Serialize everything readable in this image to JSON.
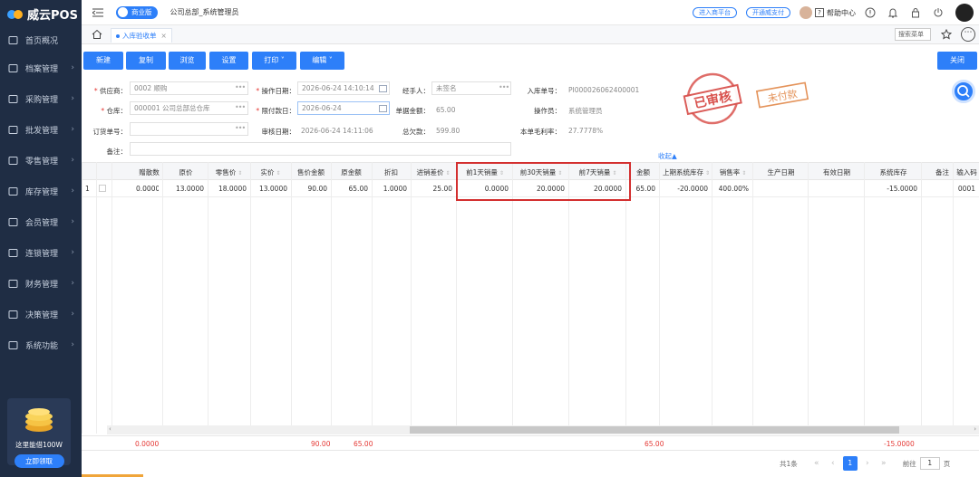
{
  "app": {
    "name": "威云POS",
    "edition": "商业版",
    "org_user": "公司总部_系统管理员"
  },
  "sidebar": {
    "items": [
      {
        "label": "首页概况",
        "icon": "home-icon"
      },
      {
        "label": "档案管理",
        "icon": "archive-icon"
      },
      {
        "label": "采购管理",
        "icon": "purchase-icon"
      },
      {
        "label": "批发管理",
        "icon": "wholesale-icon"
      },
      {
        "label": "零售管理",
        "icon": "retail-icon"
      },
      {
        "label": "库存管理",
        "icon": "inventory-icon"
      },
      {
        "label": "会员管理",
        "icon": "member-icon"
      },
      {
        "label": "连锁管理",
        "icon": "chain-icon"
      },
      {
        "label": "财务管理",
        "icon": "finance-icon"
      },
      {
        "label": "决策管理",
        "icon": "decision-icon"
      },
      {
        "label": "系统功能",
        "icon": "system-icon"
      }
    ],
    "promo": {
      "text": "这里能借100W",
      "button": "立即领取"
    }
  },
  "topbar": {
    "pill1": "进入商平台",
    "pill2": "开通威支付",
    "help": "帮助中心",
    "help_badge": "?"
  },
  "tabs": {
    "active": "入库验收单",
    "menu_search_placeholder": "搜索菜单",
    "more": "⋯"
  },
  "toolbar": {
    "new": "新建",
    "copy": "复制",
    "browse": "浏览",
    "settings": "设置",
    "print": "打印",
    "edit": "编辑",
    "close": "关闭"
  },
  "form": {
    "supplier_label": "供应商：",
    "supplier_value": "0002 顺购",
    "op_date_label": "操作日期：",
    "op_date_value": "2026-06-24 14:10:14",
    "handler_label": "经手人：",
    "handler_value": "未签名",
    "doc_no_label": "入库单号：",
    "doc_no_value": "PI000026062400001",
    "warehouse_label": "仓库：",
    "warehouse_value": "000001 公司总部总仓库",
    "pay_date_label": "限付款日：",
    "pay_date_value": "2026-06-24",
    "amount_label": "单据金额：",
    "amount_value": "65.00",
    "operator_label": "操作员：",
    "operator_value": "系统管理员",
    "order_no_label": "订货单号：",
    "order_no_value": "",
    "audit_date_label": "审核日期：",
    "audit_date_value": "2026-06-24 14:11:06",
    "debt_label": "总欠款：",
    "debt_value": "599.80",
    "margin_label": "本单毛利率：",
    "margin_value": "27.7778%",
    "remark_label": "备注：",
    "remark_value": "",
    "collapse": "收起▲",
    "stamp_audited": "已审核",
    "stamp_unpaid": "未付款"
  },
  "table": {
    "headers": [
      "赠散数",
      "原价",
      "零售价",
      "实价",
      "售价金额",
      "原金额",
      "折扣",
      "进销差价",
      "前1天销量",
      "前30天销量",
      "前7天销量",
      "金额",
      "上期系统库存",
      "销售率",
      "生产日期",
      "有效日期",
      "系统库存",
      "备注",
      "输入码"
    ],
    "rows": [
      {
        "index": "1",
        "cells": [
          "0.0000",
          "13.0000",
          "18.0000",
          "13.0000",
          "90.00",
          "65.00",
          "1.0000",
          "25.00",
          "0.0000",
          "20.0000",
          "20.0000",
          "65.00",
          "-20.0000",
          "400.00%",
          "",
          "",
          "-15.0000",
          "",
          "0001"
        ]
      }
    ]
  },
  "summary": {
    "gift_qty": "0.0000",
    "sale_amount": "90.00",
    "orig_amount": "65.00",
    "amount": "65.00",
    "stock": "-15.0000"
  },
  "pager": {
    "total": "共1条",
    "current": "1",
    "goto_label": "前往",
    "goto_value": "1",
    "page_suffix": "页"
  }
}
